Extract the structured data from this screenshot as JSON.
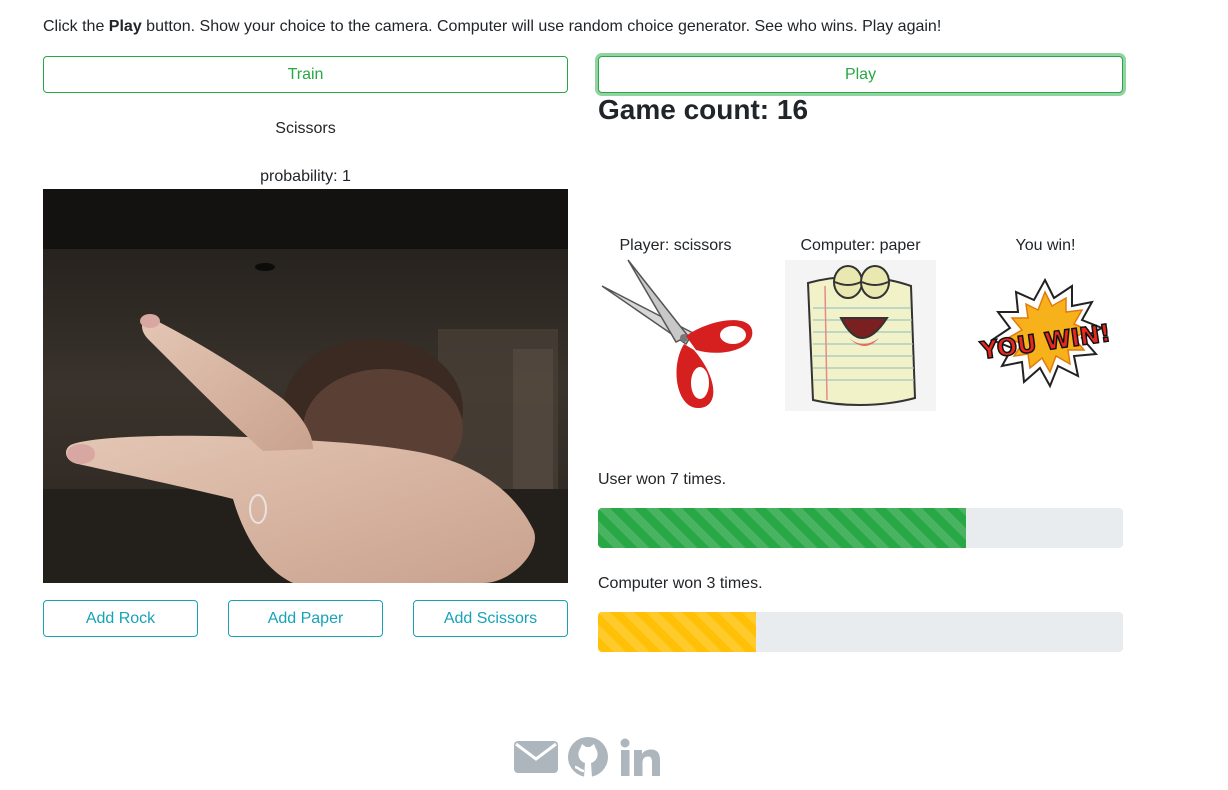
{
  "instructions": {
    "prefix": "Click the ",
    "bold": "Play",
    "suffix": " button. Show your choice to the camera. Computer will use random choice generator. See who wins. Play again!"
  },
  "buttons": {
    "train": "Train",
    "play": "Play",
    "add_rock": "Add Rock",
    "add_paper": "Add Paper",
    "add_scissors": "Add Scissors"
  },
  "prediction": {
    "label": "Scissors",
    "probability": "probability: 1"
  },
  "game": {
    "count_label": "Game count: ",
    "count": "16",
    "player_label": "Player: scissors",
    "computer_label": "Computer: paper",
    "result_label": "You win!",
    "player_icon": "scissors-icon",
    "computer_icon": "paper-cartoon-icon",
    "result_icon": "you-win-burst-icon",
    "result_image_text": "YOU WIN!"
  },
  "stats": {
    "user_label": "User won 7 times.",
    "user_fraction": 0.7,
    "computer_label": "Computer won 3 times.",
    "computer_fraction": 0.3
  },
  "colors": {
    "success": "#28a745",
    "info": "#17a2b8",
    "warning": "#ffc107",
    "track": "#e9ecef",
    "footer_icon": "#adb5bd"
  },
  "footer": {
    "icons": [
      "mail-icon",
      "github-icon",
      "linkedin-icon"
    ]
  }
}
